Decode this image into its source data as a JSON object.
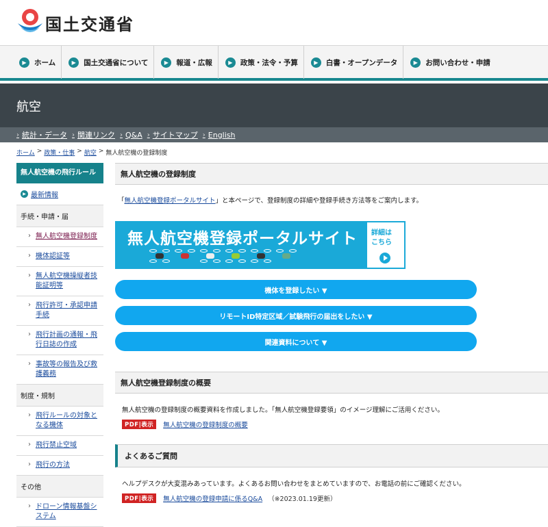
{
  "header": {
    "site_name": "国土交通省",
    "logo_icon": "mlit-logo-icon"
  },
  "gnav": [
    {
      "label": "ホーム"
    },
    {
      "label": "国土交通省について"
    },
    {
      "label": "報道・広報"
    },
    {
      "label": "政策・法令・予算"
    },
    {
      "label": "白書・オープンデータ"
    },
    {
      "label": "お問い合わせ・申請"
    }
  ],
  "section": {
    "title": "航空"
  },
  "subnav": [
    {
      "label": "統計・データ"
    },
    {
      "label": "関連リンク"
    },
    {
      "label": "Q&A"
    },
    {
      "label": "サイトマップ"
    },
    {
      "label": "English"
    }
  ],
  "breadcrumb": [
    {
      "label": "ホーム",
      "link": true
    },
    {
      "label": "政策・仕事",
      "link": true
    },
    {
      "label": "航空",
      "link": true
    },
    {
      "label": "無人航空機の登録制度",
      "link": false
    }
  ],
  "sidebar": {
    "heading": "無人航空機の飛行ルール",
    "latest": "最新情報",
    "group1": "手続・申請・届",
    "group1_items": [
      {
        "label": "無人航空機登録制度"
      },
      {
        "label": "機体認証等"
      },
      {
        "label": "無人航空機操縦者技能証明等"
      },
      {
        "label": "飛行許可・承認申請手続"
      },
      {
        "label": "飛行計画の通報・飛行日誌の作成"
      },
      {
        "label": "事故等の報告及び救護義務"
      }
    ],
    "group2": "制度・規制",
    "group2_items": [
      {
        "label": "飛行ルールの対象となる機体"
      },
      {
        "label": "飛行禁止空域"
      },
      {
        "label": "飛行の方法"
      }
    ],
    "group3": "その他",
    "group3_items": [
      {
        "label": "ドローン情報基盤システム"
      }
    ]
  },
  "main": {
    "title": "無人航空機の登録制度",
    "intro_pre": "「",
    "intro_link": "無人航空機登録ポータルサイト",
    "intro_post": "」と本ページで、登録制度の詳細や登録手続き方法等をご案内します。",
    "banner": {
      "title": "無人航空機登録ポータルサイト",
      "detail_line1": "詳細は",
      "detail_line2": "こちら"
    },
    "buttons": [
      {
        "label": "機体を登録したい ▼"
      },
      {
        "label": "リモートID特定区域／試験飛行の届出をしたい ▼"
      },
      {
        "label": "関連資料について ▼"
      }
    ],
    "overview": {
      "title": "無人航空機登録制度の概要",
      "text": "無人航空機の登録制度の概要資料を作成しました。「無人航空機登録要領」のイメージ理解にご活用ください。",
      "pdf_badge": "PDF|表示",
      "pdf_link": "無人航空機の登録制度の概要"
    },
    "faq": {
      "title": "よくあるご質問",
      "text": "ヘルプデスクが大変混みあっています。よくあるお問い合わせをまとめていますので、お電話の前にご確認ください。",
      "pdf_badge": "PDF|表示",
      "pdf_link": "無人航空機の登録申請に係るQ&A",
      "note": "（※2023.01.19更新）"
    }
  },
  "colors": {
    "teal": "#16828b",
    "dark_bar": "#3b444a",
    "pill_blue": "#11a7ef",
    "pdf_red": "#d02323"
  }
}
